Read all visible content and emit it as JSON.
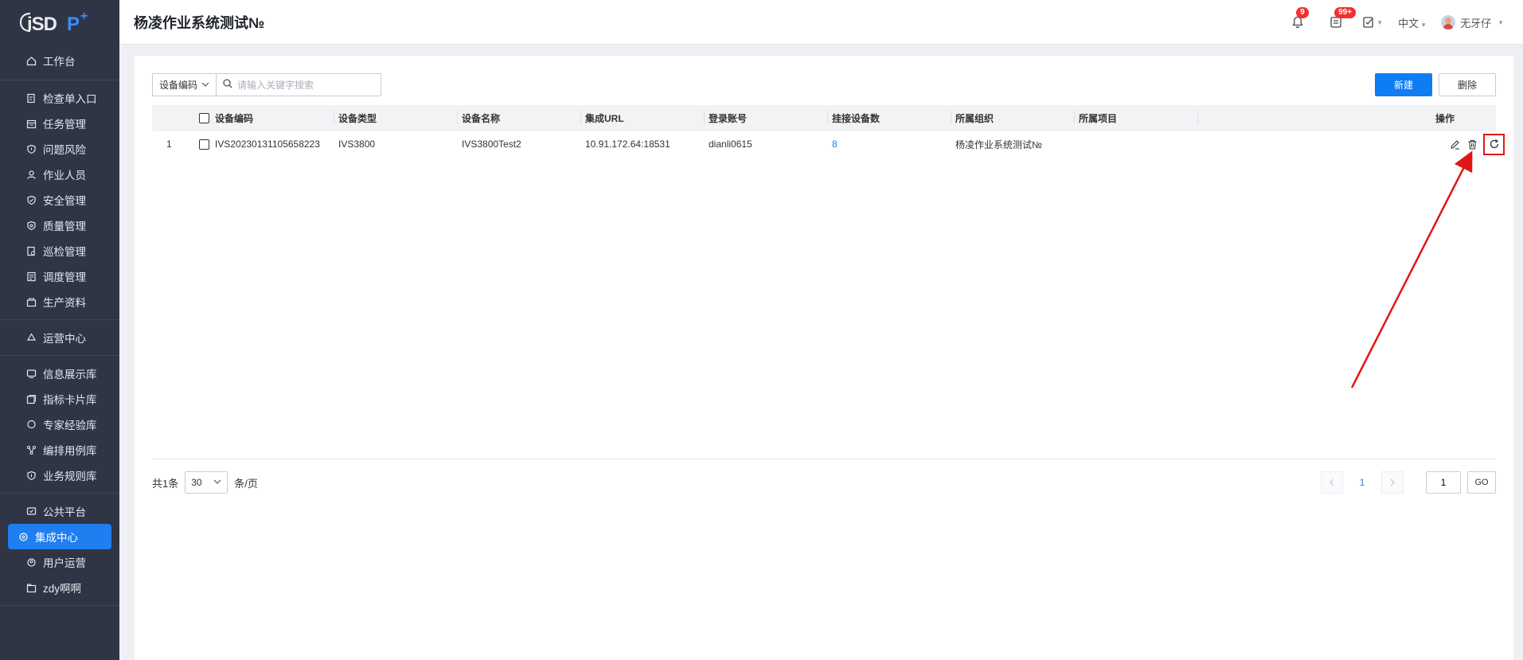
{
  "app": {
    "logo_text": "iSDP",
    "logo_sup": "+",
    "page_title": "杨凌作业系统测试№"
  },
  "colors": {
    "sidebar_bg": "#2f3545",
    "accent": "#1f7ef0",
    "primary_button": "#0e7cf2",
    "badge": "#f23030",
    "highlight_box": "#e21616"
  },
  "sidebar": {
    "groups": [
      [
        {
          "label": "工作台",
          "icon": "home-icon"
        }
      ],
      [
        {
          "label": "检查单入口",
          "icon": "checklist-icon"
        },
        {
          "label": "任务管理",
          "icon": "calendar-icon"
        },
        {
          "label": "问题风险",
          "icon": "shield-alert-icon"
        },
        {
          "label": "作业人员",
          "icon": "people-icon"
        },
        {
          "label": "安全管理",
          "icon": "shield-check-icon"
        },
        {
          "label": "质量管理",
          "icon": "shield-quality-icon"
        },
        {
          "label": "巡检管理",
          "icon": "inspect-icon"
        },
        {
          "label": "调度管理",
          "icon": "schedule-icon"
        },
        {
          "label": "生产资料",
          "icon": "materials-icon"
        }
      ],
      [
        {
          "label": "运营中心",
          "icon": "recycle-icon"
        }
      ],
      [
        {
          "label": "信息展示库",
          "icon": "display-icon"
        },
        {
          "label": "指标卡片库",
          "icon": "card-icon"
        },
        {
          "label": "专家经验库",
          "icon": "chat-icon"
        },
        {
          "label": "编排用例库",
          "icon": "flow-icon"
        },
        {
          "label": "业务规则库",
          "icon": "rule-icon"
        }
      ],
      [
        {
          "label": "公共平台",
          "icon": "platform-icon"
        },
        {
          "label": "集成中心",
          "icon": "integration-icon",
          "active": true
        },
        {
          "label": "用户运营",
          "icon": "user-ops-icon"
        },
        {
          "label": "zdy啊啊",
          "icon": "folder-icon"
        }
      ]
    ]
  },
  "header": {
    "notifications_badge": "9",
    "messages_badge": "99+",
    "language": "中文",
    "username": "无牙仔"
  },
  "toolbar": {
    "filter_field": "设备编码",
    "search_placeholder": "请输入关键字搜索",
    "new_label": "新建",
    "delete_label": "删除"
  },
  "table": {
    "columns": [
      "设备编码",
      "设备类型",
      "设备名称",
      "集成URL",
      "登录账号",
      "挂接设备数",
      "所属组织",
      "所属项目",
      "操作"
    ],
    "rows": [
      {
        "index": "1",
        "device_code": "IVS20230131105658223",
        "device_type": "IVS3800",
        "device_name": "IVS3800Test2",
        "url": "10.91.172.64:18531",
        "account": "dianli0615",
        "attached_count": "8",
        "organization": "杨凌作业系统测试№",
        "project": ""
      }
    ]
  },
  "pagination": {
    "total_text": "共1条",
    "page_size": "30",
    "per_page_label": "条/页",
    "current_page": "1",
    "jump_value": "1",
    "go_label": "GO"
  }
}
